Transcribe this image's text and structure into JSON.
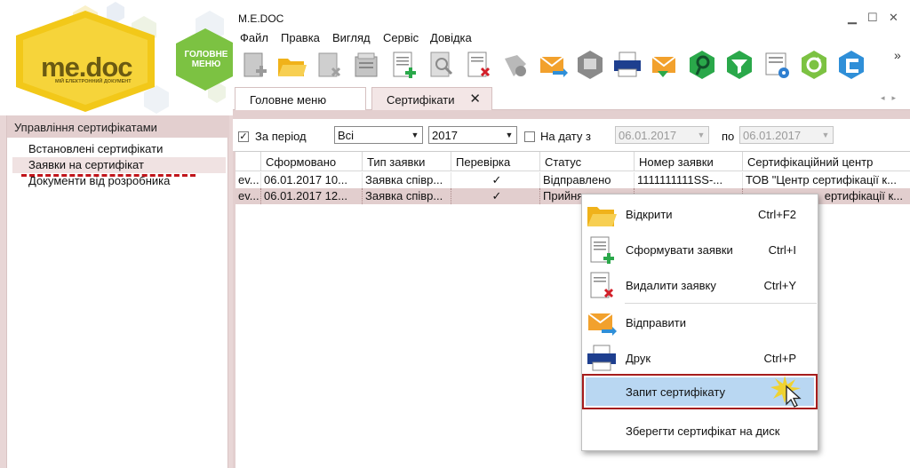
{
  "brand": {
    "logo_text": "me.doc",
    "logo_tagline": "МІЙ ЕЛЕКТРОННИЙ ДОКУМЕНТ",
    "home_label": "ГОЛОВНЕ МЕНЮ",
    "accent": "#f0c419",
    "green": "#7cc242"
  },
  "sidebar": {
    "title": "Управління сертифікатами",
    "items": [
      {
        "label": "Встановлені сертифікати"
      },
      {
        "label": "Заявки на сертифікат"
      },
      {
        "label": "Документи від розробника"
      }
    ]
  },
  "window": {
    "title": "M.E.DOC",
    "minimize": "▁",
    "maximize": "☐",
    "close": "✕"
  },
  "menubar": {
    "items": [
      "Файл",
      "Правка",
      "Вигляд",
      "Сервіс",
      "Довідка"
    ],
    "overflow": "»"
  },
  "toolbar": {
    "buttons": [
      "new-document-icon",
      "open-folder-icon",
      "delete-document-icon",
      "archive-icon",
      "create-request-icon",
      "find-document-icon",
      "remove-request-icon",
      "sign-icon",
      "send-icon",
      "certificate-icon",
      "print-icon",
      "receive-icon",
      "search-key-icon",
      "filter-icon",
      "settings-icon",
      "refresh-icon",
      "medoc-icon"
    ]
  },
  "tabs": [
    {
      "label": "Головне меню"
    },
    {
      "label": "Сертифікати",
      "close": "✕"
    }
  ],
  "filter": {
    "period_checked": true,
    "period_label": "За період",
    "period_type": "Всі",
    "year": "2017",
    "on_date_checked": false,
    "on_date_label": "На дату з",
    "date_from": "06.01.2017",
    "to_label": "по",
    "date_to": "06.01.2017"
  },
  "table": {
    "columns": [
      "Сформовано",
      "Тип заявки",
      "Перевірка",
      "Статус",
      "Номер заявки",
      "Сертифікаційний центр"
    ],
    "rows": [
      {
        "prefix": "ev...",
        "formed": "06.01.2017 10...",
        "type": "Заявка співр...",
        "check": "✓",
        "status": "Відправлено",
        "number": "1111111111SS-...",
        "center": "ТОВ \"Центр сертифікації к..."
      },
      {
        "prefix": "ev...",
        "formed": "06.01.2017 12...",
        "type": "Заявка співр...",
        "check": "✓",
        "status": "Прийня",
        "number": "",
        "center": "ертифікації к..."
      }
    ]
  },
  "context_menu": {
    "items": [
      {
        "label": "Відкрити",
        "shortcut": "Ctrl+F2"
      },
      {
        "label": "Сформувати заявки",
        "shortcut": "Ctrl+I"
      },
      {
        "label": "Видалити заявку",
        "shortcut": "Ctrl+Y"
      },
      {
        "label": "Відправити",
        "shortcut": ""
      },
      {
        "label": "Друк",
        "shortcut": "Ctrl+P"
      },
      {
        "label": "Запит сертифікату",
        "shortcut": ""
      },
      {
        "label": "Зберегти сертифікат на диск",
        "shortcut": ""
      }
    ],
    "highlight_color": "#b9d7f2",
    "highlight_border": "#a61d1d"
  }
}
